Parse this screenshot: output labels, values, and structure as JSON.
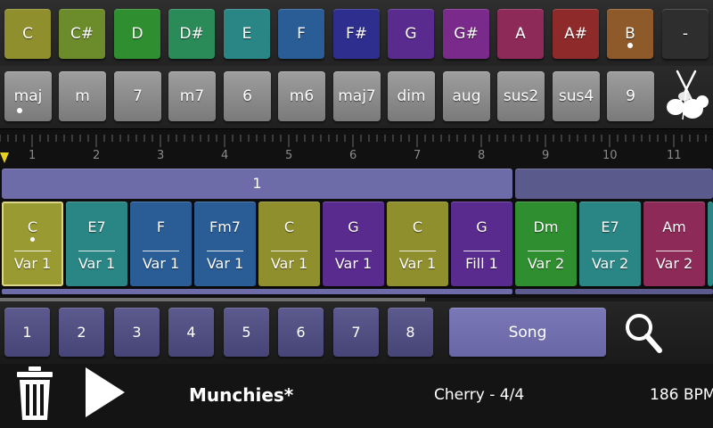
{
  "root_notes": [
    {
      "label": "C",
      "color": "#8f8f2e"
    },
    {
      "label": "C#",
      "color": "#6c8c2c"
    },
    {
      "label": "D",
      "color": "#2f8e2f"
    },
    {
      "label": "D#",
      "color": "#2a8a58"
    },
    {
      "label": "E",
      "color": "#2a8585"
    },
    {
      "label": "F",
      "color": "#2a5d96"
    },
    {
      "label": "F#",
      "color": "#2e2e8e"
    },
    {
      "label": "G",
      "color": "#5a2b8e"
    },
    {
      "label": "G#",
      "color": "#7a2a8a"
    },
    {
      "label": "A",
      "color": "#8e2a58"
    },
    {
      "label": "A#",
      "color": "#8e2a2a"
    },
    {
      "label": "B",
      "color": "#8e5a2a",
      "selected": true
    },
    {
      "label": "-",
      "color": "#2e2e2e"
    }
  ],
  "chord_types": [
    "maj",
    "m",
    "7",
    "m7",
    "6",
    "m6",
    "maj7",
    "dim",
    "aug",
    "sus2",
    "sus4",
    "9"
  ],
  "ruler_labels": [
    "1",
    "2",
    "3",
    "4",
    "5",
    "6",
    "7",
    "8",
    "9",
    "10",
    "11"
  ],
  "sections": [
    {
      "label": "1"
    },
    {
      "label": ""
    }
  ],
  "chords": [
    {
      "chord": "C",
      "pattern": "Var 1",
      "color": "#9a9a32",
      "selected": true
    },
    {
      "chord": "E7",
      "pattern": "Var 1",
      "color": "#2a8585"
    },
    {
      "chord": "F",
      "pattern": "Var 1",
      "color": "#2a5d96"
    },
    {
      "chord": "Fm7",
      "pattern": "Var 1",
      "color": "#2a5d96"
    },
    {
      "chord": "C",
      "pattern": "Var 1",
      "color": "#8f8f2e"
    },
    {
      "chord": "G",
      "pattern": "Var 1",
      "color": "#5a2b8e"
    },
    {
      "chord": "C",
      "pattern": "Var 1",
      "color": "#8f8f2e"
    },
    {
      "chord": "G",
      "pattern": "Fill 1",
      "color": "#5a2b8e"
    },
    {
      "chord": "Dm",
      "pattern": "Var 2",
      "color": "#2f8e2f"
    },
    {
      "chord": "E7",
      "pattern": "Var 2",
      "color": "#2a8585"
    },
    {
      "chord": "Am",
      "pattern": "Var 2",
      "color": "#8e2a58"
    }
  ],
  "section_buttons": [
    "1",
    "2",
    "3",
    "4",
    "5",
    "6",
    "7",
    "8"
  ],
  "song_button": "Song",
  "transport": {
    "song_name": "Munchies*",
    "style_info": "Cherry - 4/4",
    "tempo": "186 BPM"
  }
}
